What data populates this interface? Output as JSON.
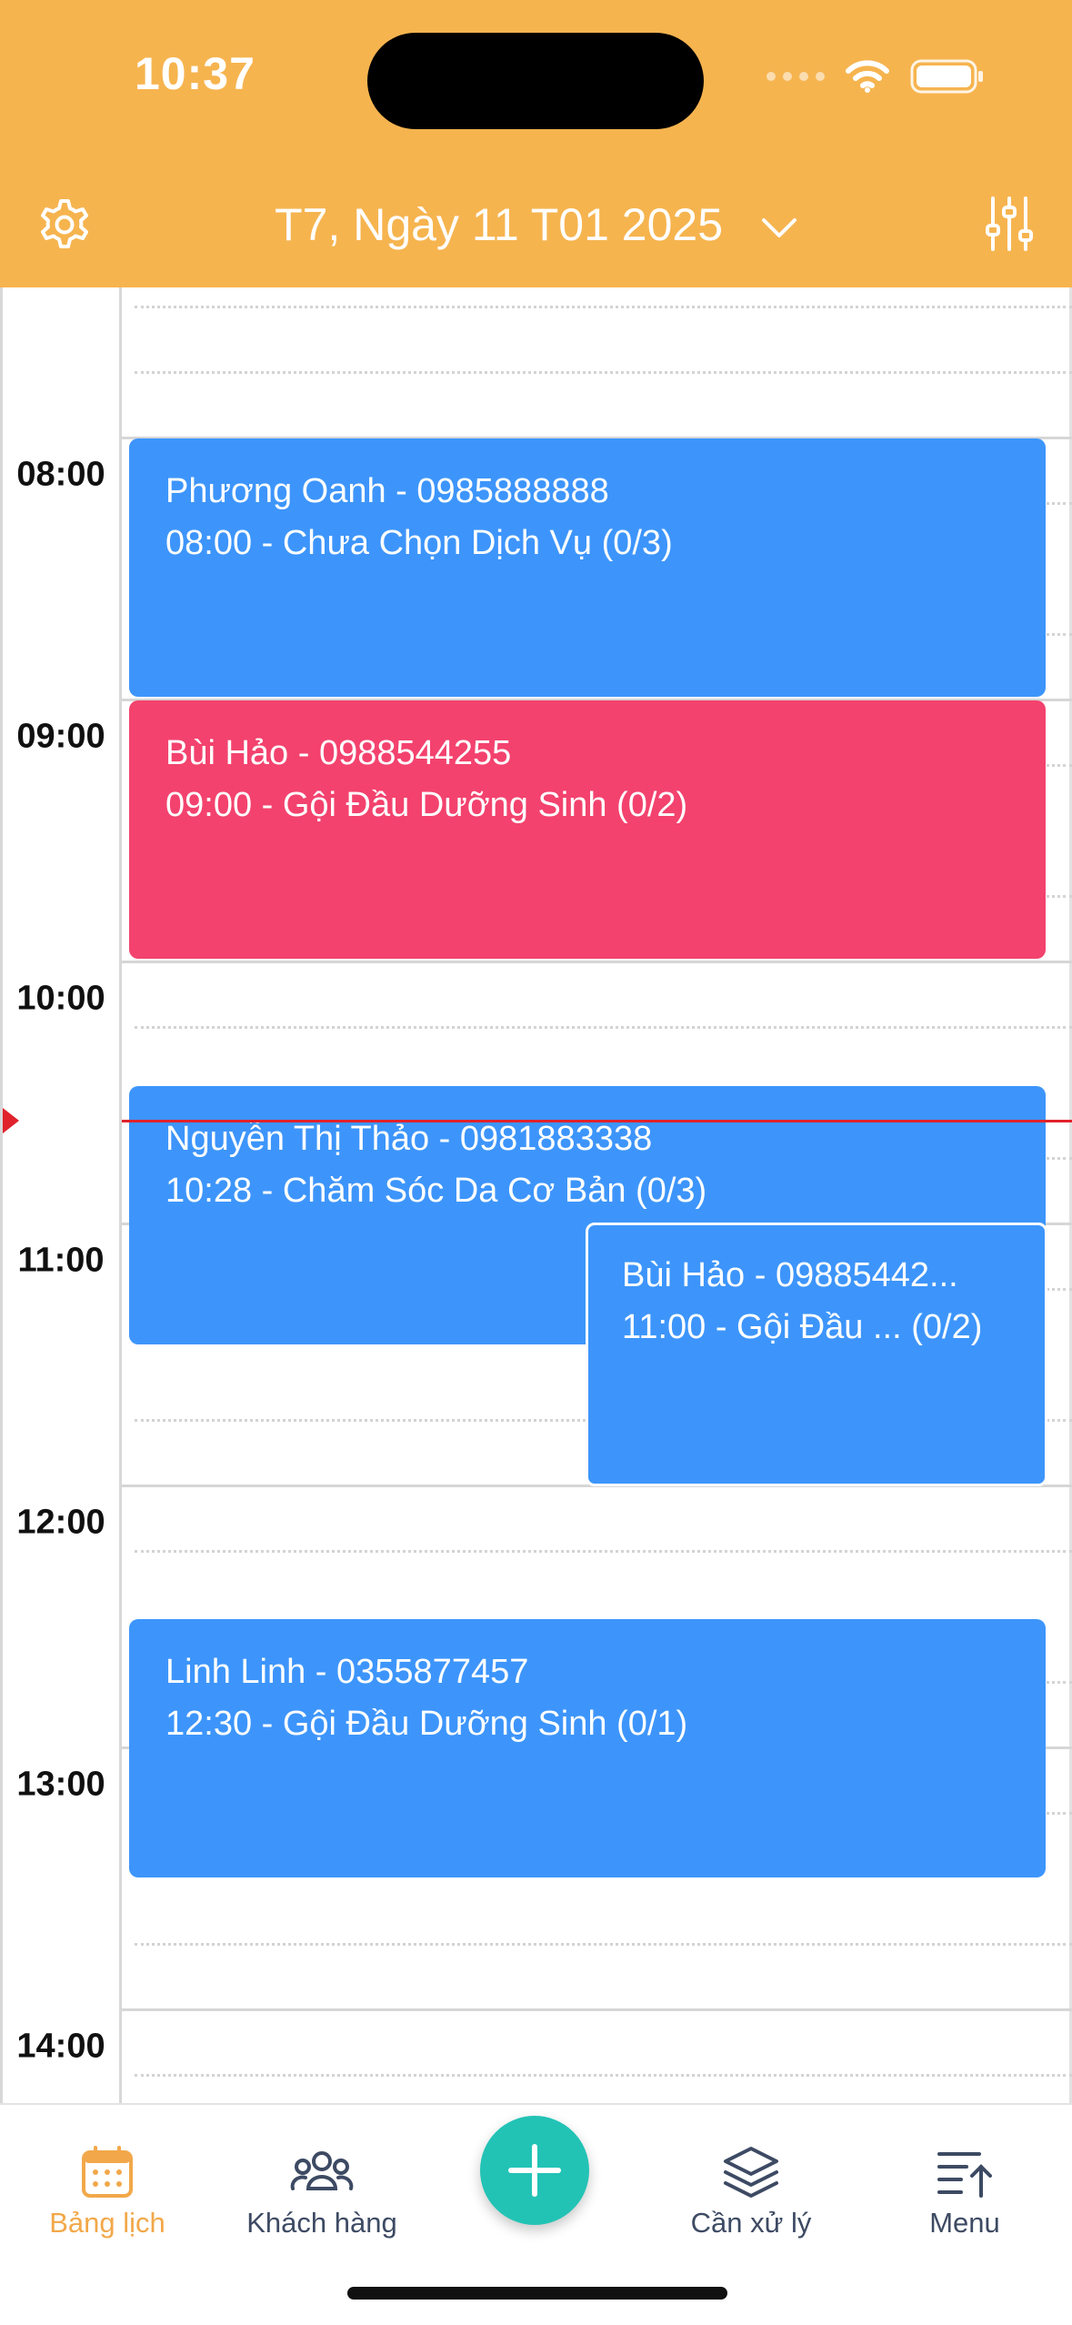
{
  "status_bar": {
    "time": "10:37"
  },
  "header": {
    "date_title": "T7, Ngày 11 T01 2025"
  },
  "time_labels": [
    "08:00",
    "09:00",
    "10:00",
    "11:00",
    "12:00",
    "13:00",
    "14:00"
  ],
  "events": [
    {
      "title": "Phương Oanh - 0985888888",
      "detail": "08:00 - Chưa Chọn Dịch Vụ (0/3)",
      "color": "#3D95FB"
    },
    {
      "title": "Bùi Hảo - 0988544255",
      "detail": "09:00 - Gội Đầu Dưỡng Sinh (0/2)",
      "color": "#F3426E"
    },
    {
      "title": "Nguyễn Thị Thảo - 0981883338",
      "detail": "10:28 - Chăm Sóc Da Cơ Bản (0/3)",
      "color": "#3D95FB"
    },
    {
      "title": "Bùi Hảo - 09885442...",
      "detail": "11:00 - Gội Đầu ... (0/2)",
      "color": "#3D95FB"
    },
    {
      "title": "Linh Linh - 0355877457",
      "detail": "12:30 - Gội Đầu Dưỡng Sinh (0/1)",
      "color": "#3D95FB"
    }
  ],
  "tabs": [
    {
      "label": "Bảng lịch",
      "icon": "calendar-icon",
      "active": true
    },
    {
      "label": "Khách hàng",
      "icon": "customers-icon",
      "active": false
    },
    {
      "label": "Cần xử lý",
      "icon": "layers-icon",
      "active": false
    },
    {
      "label": "Menu",
      "icon": "menu-sort-icon",
      "active": false
    }
  ],
  "colors": {
    "header": "#F6B44F",
    "event_blue": "#3D95FB",
    "event_pink": "#F3426E",
    "fab": "#22C3B5",
    "active_tab": "#F2A84A",
    "now_line": "#E0222C"
  }
}
